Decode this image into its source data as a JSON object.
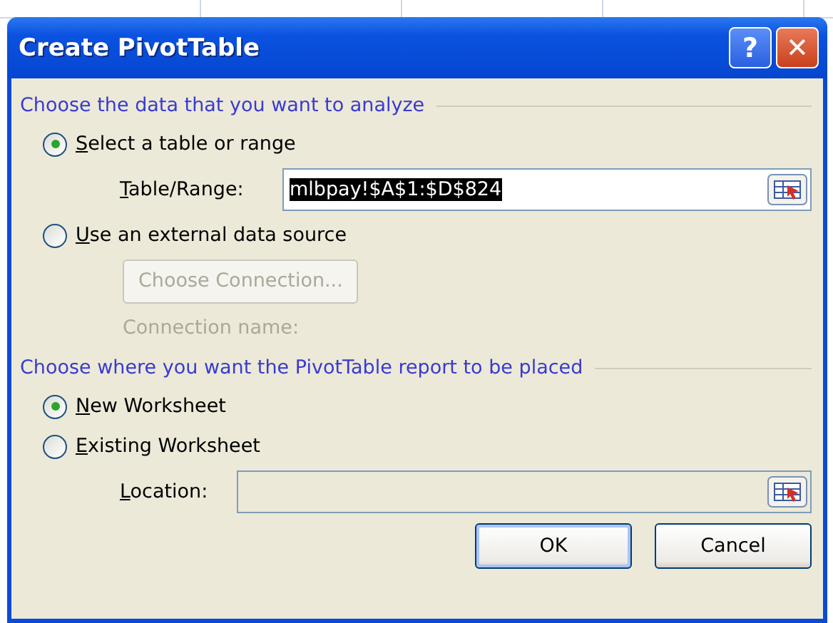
{
  "window": {
    "title": "Create PivotTable",
    "buttons": [
      {
        "kind": "help",
        "label": "?"
      },
      {
        "kind": "close",
        "label": "✕"
      }
    ]
  },
  "sections": [
    {
      "heading": "Choose the data that you want to analyze",
      "options": [
        {
          "label": "Select a table or range",
          "selected": true,
          "field": {
            "label": "Table/Range:",
            "value": "mlbpay!$A$1:$D$824",
            "value_selected": true,
            "disabled": false
          }
        },
        {
          "label": "Use an external data source",
          "selected": false,
          "button": {
            "label": "Choose Connection...",
            "disabled": true
          },
          "note": {
            "label": "Connection name:",
            "disabled": true
          }
        }
      ]
    },
    {
      "heading": "Choose where you want the PivotTable report to be placed",
      "options": [
        {
          "label": "New Worksheet",
          "selected": true
        },
        {
          "label": "Existing Worksheet",
          "selected": false,
          "field": {
            "label": "Location:",
            "disabled": true
          }
        }
      ]
    }
  ],
  "buttons": [
    {
      "label": "OK",
      "default": true
    },
    {
      "label": "Cancel",
      "default": false
    }
  ]
}
